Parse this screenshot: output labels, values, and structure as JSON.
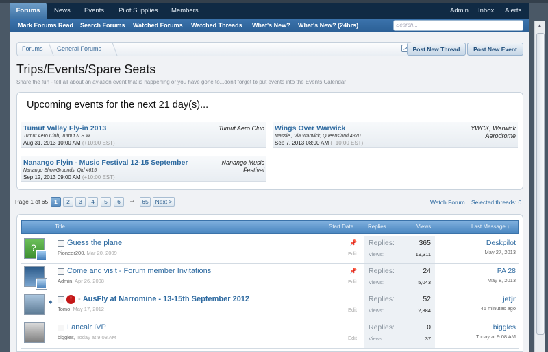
{
  "nav": {
    "tabs": [
      "Forums",
      "News",
      "Events",
      "Pilot Supplies",
      "Members"
    ],
    "right": [
      "Admin",
      "Inbox",
      "Alerts"
    ],
    "sub_links": [
      "Mark Forums Read",
      "Search Forums",
      "Watched Forums",
      "Watched Threads",
      "What's New?",
      "What's New? (24hrs)"
    ],
    "search_placeholder": "Search..."
  },
  "breadcrumb": [
    "Forums",
    "General Forums"
  ],
  "buttons": {
    "post_thread": "Post New Thread",
    "post_event": "Post New Event"
  },
  "page": {
    "title": "Trips/Events/Spare Seats",
    "subtitle": "Share the fun - tell all about an aviation event that is happening or you have gone to...don't forget to put events into the Events Calendar"
  },
  "events": {
    "heading": "Upcoming events for the next 21 day(s)...",
    "items": [
      {
        "title": "Tumut Valley Fly-in 2013",
        "location": "Tumut Aero Club, Tumut N.S.W",
        "date": "Aug 31, 2013 10:00 AM",
        "tz": "(+10:00 EST)",
        "organizer": "Tumut Aero Club"
      },
      {
        "title": "Wings Over Warwick",
        "location": "Massie,, Via Warwick, Queensland 4370",
        "date": "Sep 7, 2013 08:00 AM",
        "tz": "(+10:00 EST)",
        "organizer": "YWCK, Warwick Aerodrome"
      },
      {
        "title": "Nanango Flyin - Music Festival 12-15 September",
        "location": "Nanango ShowGrounds, Qld 4615",
        "date": "Sep 12, 2013 09:00 AM",
        "tz": "(+10:00 EST)",
        "organizer": "Nanango Music Festival"
      }
    ]
  },
  "pagination": {
    "label": "Page 1 of 65",
    "pages": [
      "1",
      "2",
      "3",
      "4",
      "5",
      "6"
    ],
    "arrow": "→",
    "last": "65",
    "next": "Next >",
    "watch": "Watch Forum",
    "selected": "Selected threads: 0"
  },
  "table_header": {
    "title": "Title",
    "start_date": "Start Date",
    "replies": "Replies",
    "views": "Views",
    "last_message": "Last Message ↓"
  },
  "stat_labels": {
    "replies": "Replies:",
    "views": "Views:"
  },
  "edit_label": "Edit",
  "threads": [
    {
      "title": "Guess the plane",
      "author": "Pioneer200",
      "date": "Mar 20, 2009",
      "replies": "365",
      "views": "19,311",
      "last_user": "Deskpilot",
      "last_time": "May 27, 2013"
    },
    {
      "title": "Come and visit - Forum member Invitations",
      "author": "Admin",
      "date": "Apr 26, 2008",
      "replies": "24",
      "views": "5,043",
      "last_user": "PA 28",
      "last_time": "May 8, 2013"
    },
    {
      "title": "AusFly at Narromine - 13-15th September 2012",
      "author": "Tomo",
      "date": "May 17, 2012",
      "replies": "52",
      "views": "2,884",
      "last_user": "jetjr",
      "last_time": "45 minutes ago"
    },
    {
      "title": "Lancair IVP",
      "author": "biggles",
      "date": "Today at 9:08 AM",
      "replies": "0",
      "views": "37",
      "last_user": "biggles",
      "last_time": "Today at 9:08 AM"
    }
  ],
  "icons": {
    "pin": "pin-icon",
    "alert": "alert-icon",
    "external": "external-link-icon"
  },
  "colors": {
    "nav_dark": "#102a44",
    "nav_blue": "#2b5f95",
    "link": "#2e6aa0",
    "header_blue": "#4a86c0",
    "alert_red": "#c41717"
  }
}
